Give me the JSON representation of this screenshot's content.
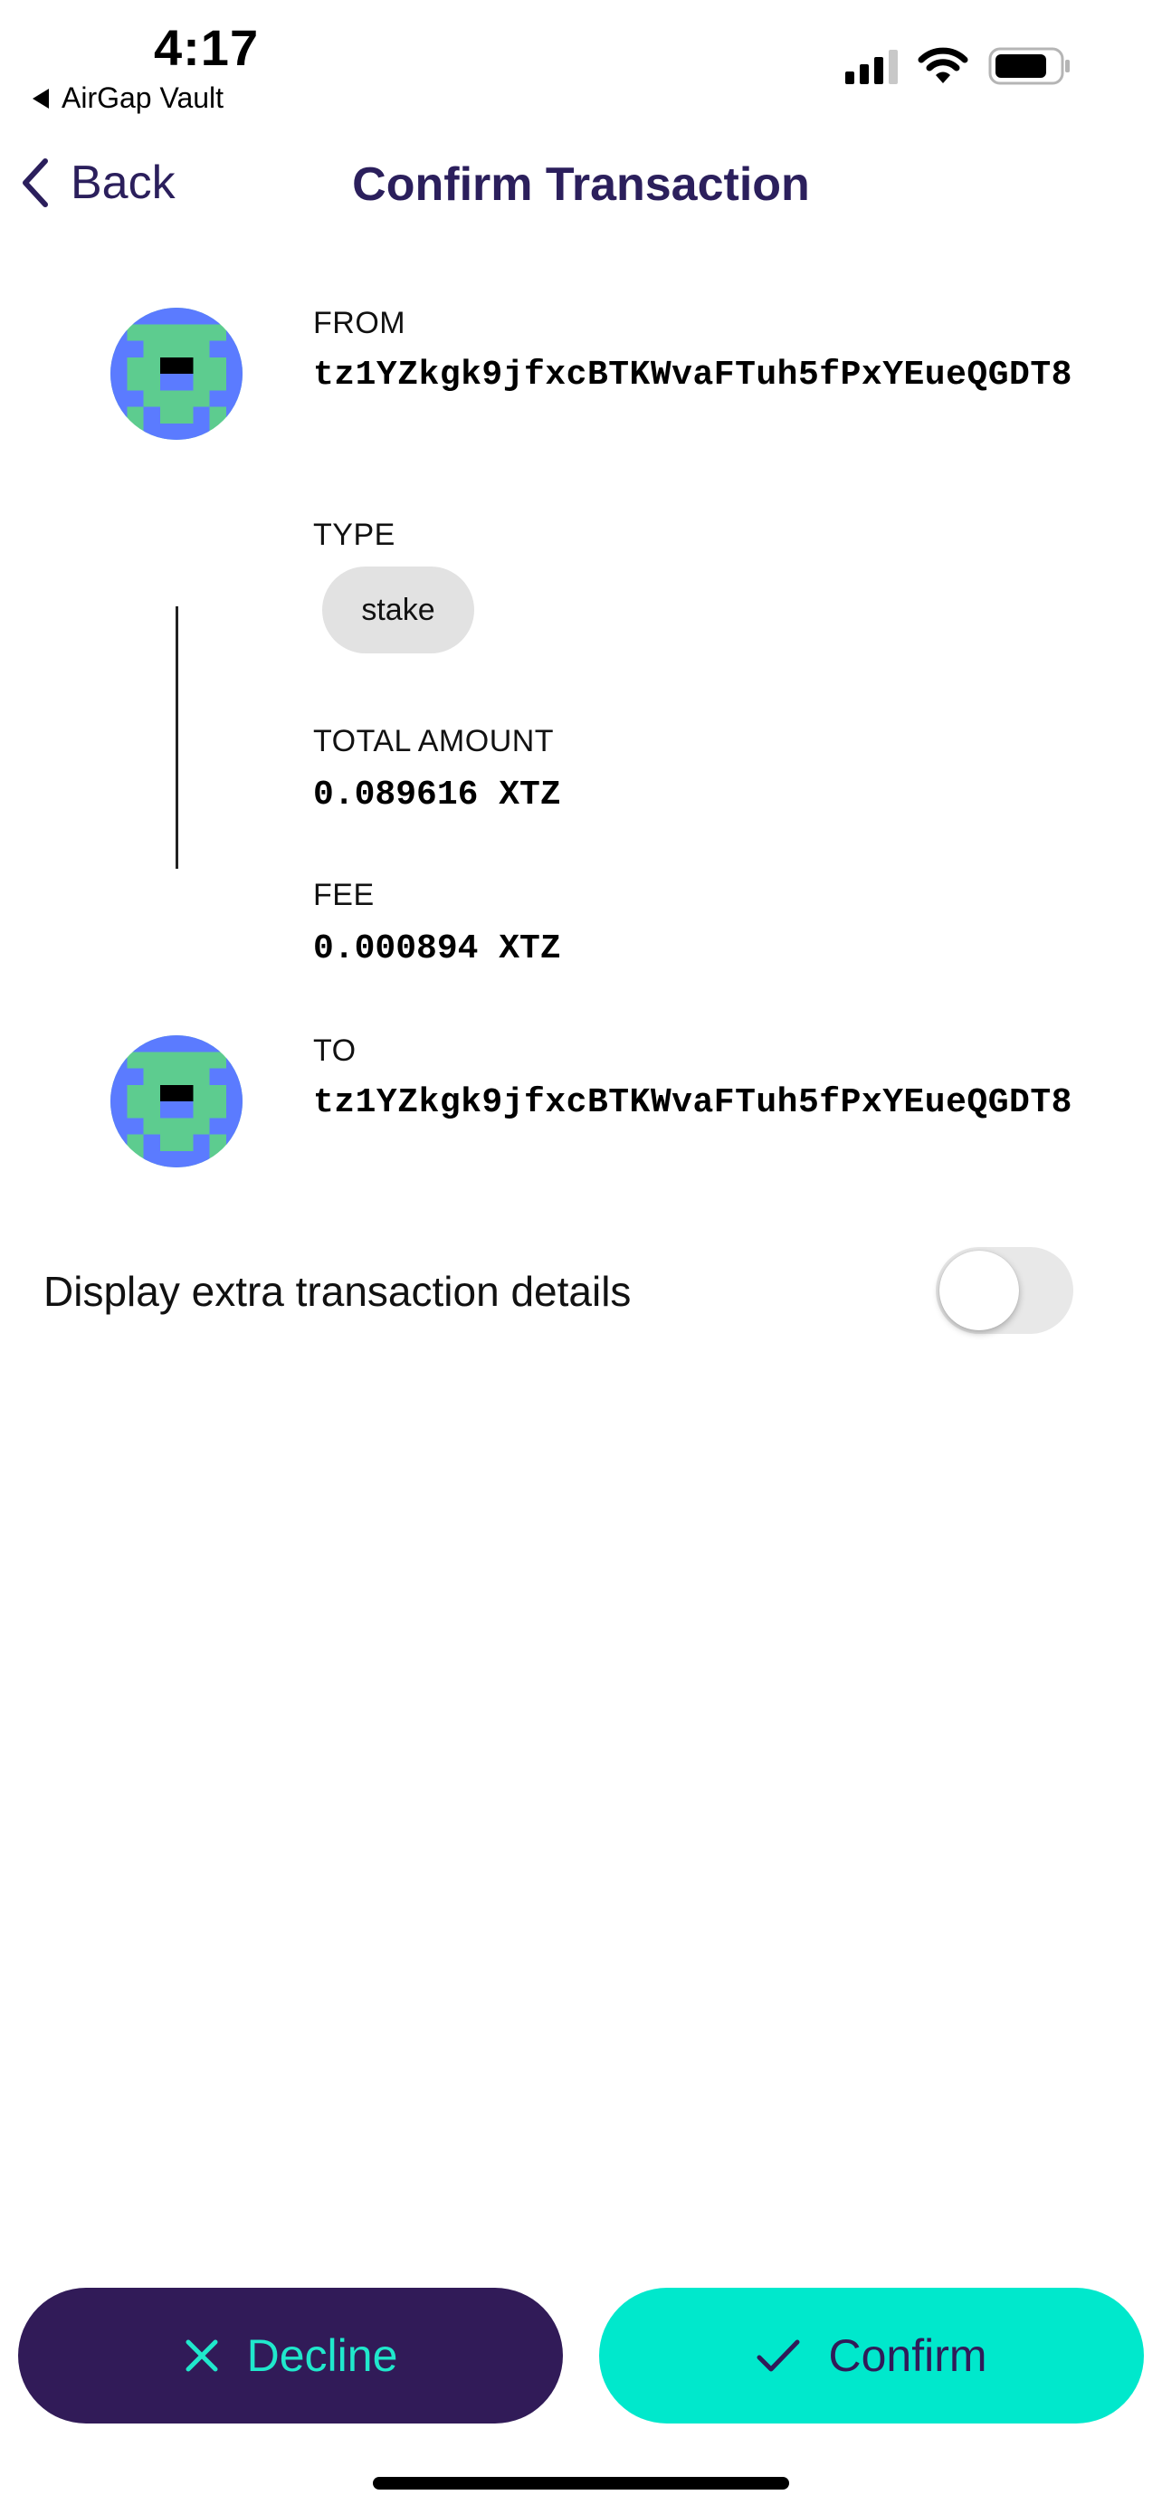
{
  "status_bar": {
    "time": "4:17",
    "back_app": "AirGap Vault",
    "signal_icon": "cellular-signal-icon",
    "wifi_icon": "wifi-icon",
    "battery_icon": "battery-icon"
  },
  "header": {
    "back_label": "Back",
    "title": "Confirm Transaction"
  },
  "transaction": {
    "from_label": "FROM",
    "from_address": "tz1YZkgk9jfxcBTKWvaFTuh5fPxYEueQGDT8",
    "type_label": "TYPE",
    "type_value": "stake",
    "amount_label": "TOTAL AMOUNT",
    "amount_value": "0.089616 XTZ",
    "fee_label": "FEE",
    "fee_value": "0.000894 XTZ",
    "to_label": "TO",
    "to_address": "tz1YZkgk9jfxcBTKWvaFTuh5fPxYEueQGDT8"
  },
  "extra_details": {
    "label": "Display extra transaction details",
    "enabled": false
  },
  "actions": {
    "decline_label": "Decline",
    "confirm_label": "Confirm"
  },
  "colors": {
    "primary_dark": "#311b58",
    "accent_teal": "#00e8cc",
    "title_purple": "#2b1f5c",
    "identicon_blue": "#5b7bff",
    "identicon_green": "#5dcc8f"
  }
}
